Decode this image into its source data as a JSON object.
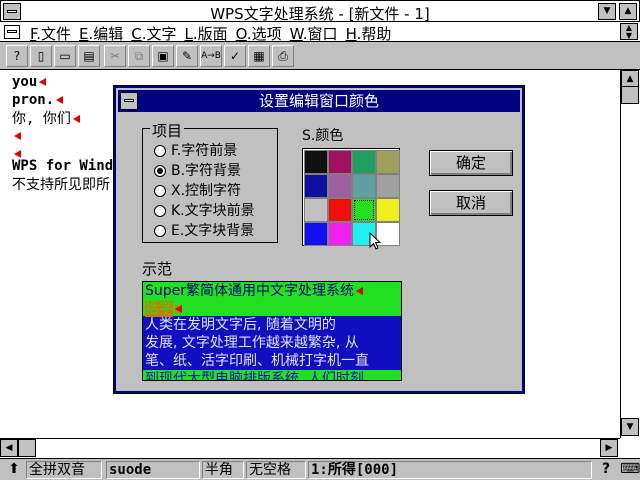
{
  "window": {
    "title": "WPS文字处理系统 - [新文件 - 1]"
  },
  "menu": {
    "items": [
      "F.文件",
      "E.编辑",
      "C.文字",
      "L.版面",
      "O.选项",
      "W.窗口",
      "H.帮助"
    ]
  },
  "toolbar": {
    "buttons": [
      "help",
      "new",
      "open",
      "save",
      "cut",
      "copy",
      "paste",
      "format",
      "replace",
      "spell",
      "calc",
      "print"
    ]
  },
  "document": {
    "lines": [
      "you",
      "pron.",
      "你, 你们",
      "",
      "",
      "WPS for Windo",
      "不支持所见即所"
    ]
  },
  "dialog": {
    "title": "设置编辑窗口颜色",
    "group_label": "项目",
    "options": [
      {
        "key": "F",
        "label": "F.字符前景",
        "selected": false
      },
      {
        "key": "B",
        "label": "B.字符背景",
        "selected": true
      },
      {
        "key": "X",
        "label": "X.控制字符",
        "selected": false
      },
      {
        "key": "K",
        "label": "K.文字块前景",
        "selected": false
      },
      {
        "key": "E",
        "label": "E.文字块背景",
        "selected": false
      }
    ],
    "color_label": "S.颜色",
    "colors": [
      "#101010",
      "#a01060",
      "#20a060",
      "#a0a060",
      "#1010a0",
      "#a060a0",
      "#60a0a0",
      "#a0a0a0",
      "#c0c0c0",
      "#f01010",
      "#20e020",
      "#f0f020",
      "#1010f0",
      "#f020f0",
      "#20f0f0",
      "#ffffff"
    ],
    "selected_color_index": 10,
    "ok_label": "确定",
    "cancel_label": "取消",
    "demo_label": "示范",
    "demo": {
      "line1": "Super繁简体通用中文字处理系统",
      "line2": "括字",
      "block": [
        "    人类在发明文字后, 随着文明的",
        "发展, 文字处理工作越来越繁杂, 从"
      ],
      "block3": "笔、纸、活字印刷、机械打字机一直",
      "block4": "到现代大型电脑排版系统, 人们时刻"
    }
  },
  "status": {
    "input_method": "全拼双音",
    "code": "suode",
    "width": "半角",
    "spacing": "无空格",
    "candidate": "1:所得[000]"
  },
  "colors": {
    "title_bg": "#000080",
    "face": "#c0c0c0",
    "marker": "#e00000"
  }
}
